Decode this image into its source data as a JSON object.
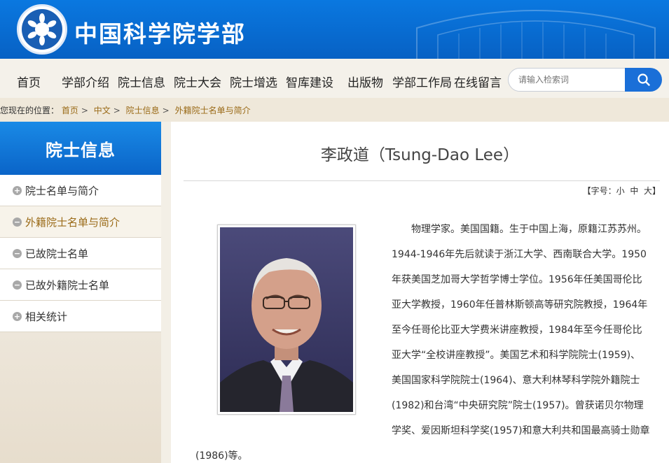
{
  "header": {
    "site_title": "中国科学院学部"
  },
  "nav": {
    "items": [
      "首页",
      "学部介绍",
      "院士信息",
      "院士大会",
      "院士增选",
      "智库建设",
      "出版物",
      "学部工作局",
      "在线留言"
    ]
  },
  "search": {
    "placeholder": "请输入检索词",
    "icon": "search-icon"
  },
  "breadcrumb": {
    "prefix": "您现在的位置：",
    "items": [
      "首页",
      "中文",
      "院士信息",
      "外籍院士名单与简介"
    ]
  },
  "sidebar": {
    "title": "院士信息",
    "items": [
      {
        "label": "院士名单与简介",
        "icon": "plus-icon"
      },
      {
        "label": "外籍院士名单与简介",
        "icon": "minus-icon"
      },
      {
        "label": "已故院士名单",
        "icon": "minus-icon"
      },
      {
        "label": "已故外籍院士名单",
        "icon": "minus-icon"
      },
      {
        "label": "相关统计",
        "icon": "plus-icon"
      }
    ]
  },
  "article": {
    "title": "李政道（Tsung-Dao Lee）",
    "font_size": {
      "open": "【",
      "label": "字号：",
      "small": "小",
      "medium": "中",
      "large": "大",
      "close": "】"
    },
    "bio_lines": [
      "　　物理学家。美国国籍。生于中国上海，原籍江苏苏州。",
      "1944-1946年先后就读于浙江大学、西南联合大学。1950",
      "年获美国芝加哥大学哲学博士学位。1956年任美国哥伦比",
      "亚大学教授，1960年任普林斯顿高等研究院教授，1964年",
      "至今任哥伦比亚大学费米讲座教授，1984年至今任哥伦比",
      "亚大学“全校讲座教授”。美国艺术和科学院院士(1959)、",
      "美国国家科学院院士(1964)、意大利林琴科学院外籍院士",
      "(1982)和台湾“中央研究院”院士(1957)。曾获诺贝尔物理",
      "学奖、爱因斯坦科学奖(1957)和意大利共和国最高骑士勋章"
    ],
    "bio_tail": "(1986)等。"
  },
  "colors": {
    "header_blue": "#0a6fd6",
    "link_brown": "#9a6a17",
    "search_blue": "#1a6fd8"
  }
}
